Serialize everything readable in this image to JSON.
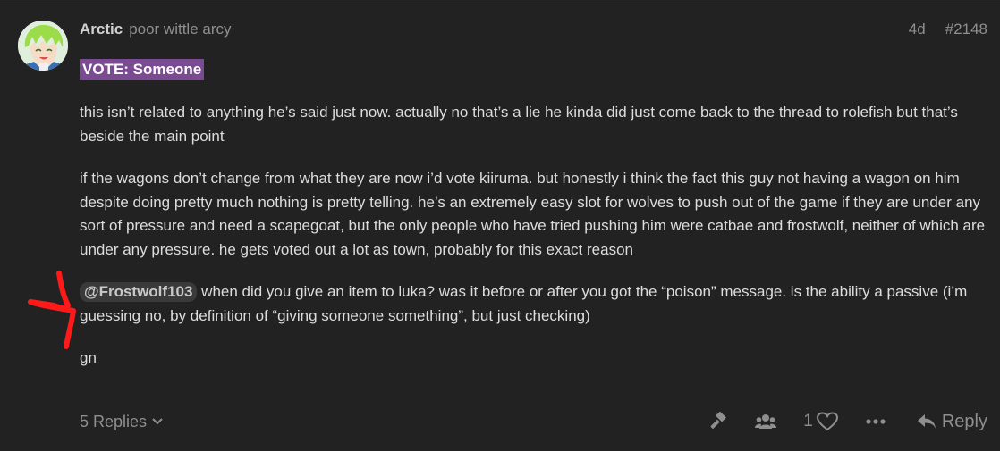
{
  "post": {
    "username": "Arctic",
    "user_title": "poor wittle arcy",
    "age": "4d",
    "post_number": "#2148",
    "vote": "VOTE: Someone",
    "paragraph_1": "this isn’t related to anything he’s said just now. actually no that’s a lie he kinda did just come back to the thread to rolefish but that’s beside the main point",
    "paragraph_2": "if the wagons don’t change from what they are now i’d vote kiiruma. but honestly i think the fact this guy not having a wagon on him despite doing pretty much nothing is pretty telling. he’s an extremely easy slot for wolves to push out of the game if they are under any sort of pressure and need a scapegoat, but the only people who have tried pushing him were catbae and frostwolf, neither of which are under any pressure. he gets voted out a lot as town, probably for this exact reason",
    "mention": "@Frostwolf103",
    "paragraph_3_rest": " when did you give an item to luka? was it before or after you got the “poison” message. is the ability a passive (i’m guessing no, by definition of “giving someone something”, but just checking)",
    "paragraph_4": "gn"
  },
  "footer": {
    "replies_label": "5 Replies",
    "like_count": "1",
    "reply_label": "Reply"
  },
  "colors": {
    "background": "#222222",
    "vote_highlight": "#7a4a92",
    "annotation": "#ff1a1a"
  }
}
